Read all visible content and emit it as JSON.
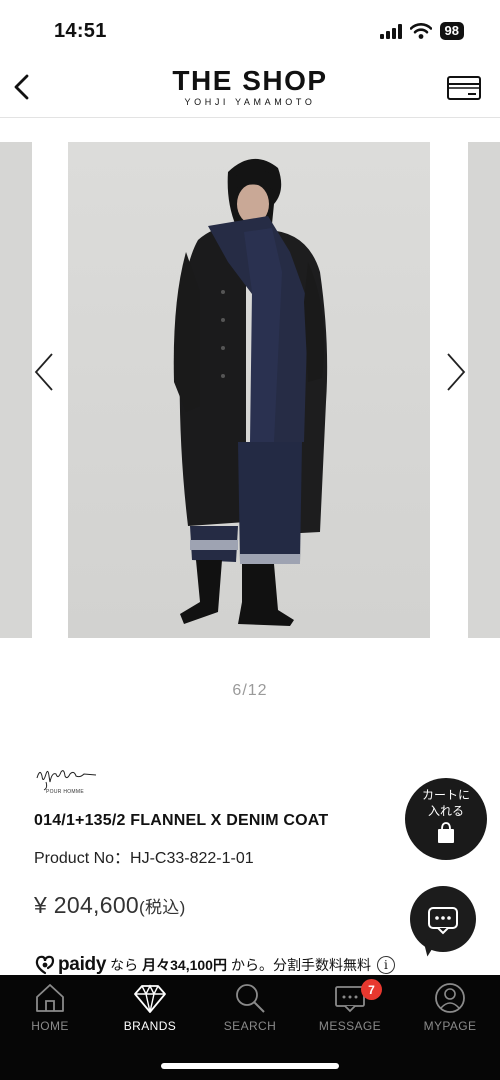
{
  "status_bar": {
    "time": "14:51",
    "battery": "98"
  },
  "header": {
    "logo_main": "THE SHOP",
    "logo_sub": "YOHJI YAMAMOTO"
  },
  "gallery": {
    "counter": "6/12"
  },
  "product": {
    "brand_line": "POUR HOMME",
    "name": "014/1+135/2 FLANNEL X DENIM COAT",
    "product_no": "Product No：HJ-C33-822-1-01",
    "price": "¥ 204,600",
    "price_tax": "(税込)"
  },
  "paidy": {
    "logo": "paidy",
    "text_pre": "なら",
    "text_bold": "月々34,100円",
    "text_post": "から。分割手数料無料",
    "info": "i"
  },
  "cart_fab": {
    "line1": "カートに",
    "line2": "入れる"
  },
  "bottom_nav": {
    "items": [
      {
        "label": "HOME",
        "icon": "home-icon"
      },
      {
        "label": "BRANDS",
        "icon": "diamond-icon"
      },
      {
        "label": "SEARCH",
        "icon": "search-icon"
      },
      {
        "label": "MESSAGE",
        "icon": "message-icon",
        "badge": "7"
      },
      {
        "label": "MYPAGE",
        "icon": "user-icon"
      }
    ],
    "active": "BRANDS"
  },
  "colors": {
    "accent_badge": "#e8382f",
    "nav_bg": "#060606",
    "fab_bg": "#1a1a1a"
  }
}
